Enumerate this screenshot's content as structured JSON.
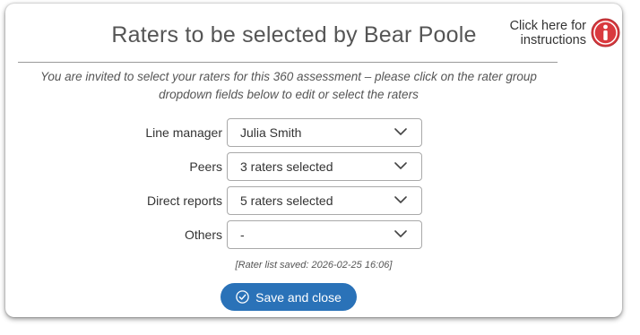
{
  "dialog": {
    "title": "Raters to be selected by Bear Poole",
    "help": {
      "line1": "Click here for",
      "line2": "instructions",
      "icon": "info-icon",
      "icon_color": "#d9393e"
    },
    "intro": "You are invited to select your raters for this 360 assessment – please click on the rater group dropdown fields below to edit or select the raters",
    "rows": [
      {
        "label": "Line manager",
        "value": "Julia Smith"
      },
      {
        "label": "Peers",
        "value": "3 raters selected"
      },
      {
        "label": "Direct reports",
        "value": "5 raters selected"
      },
      {
        "label": "Others",
        "value": "-"
      }
    ],
    "saved_note": "[Rater list saved: 2026-02-25 16:06]",
    "save_button": {
      "label": "Save and close",
      "icon": "check-circle-icon",
      "color": "#2a72b8"
    }
  }
}
